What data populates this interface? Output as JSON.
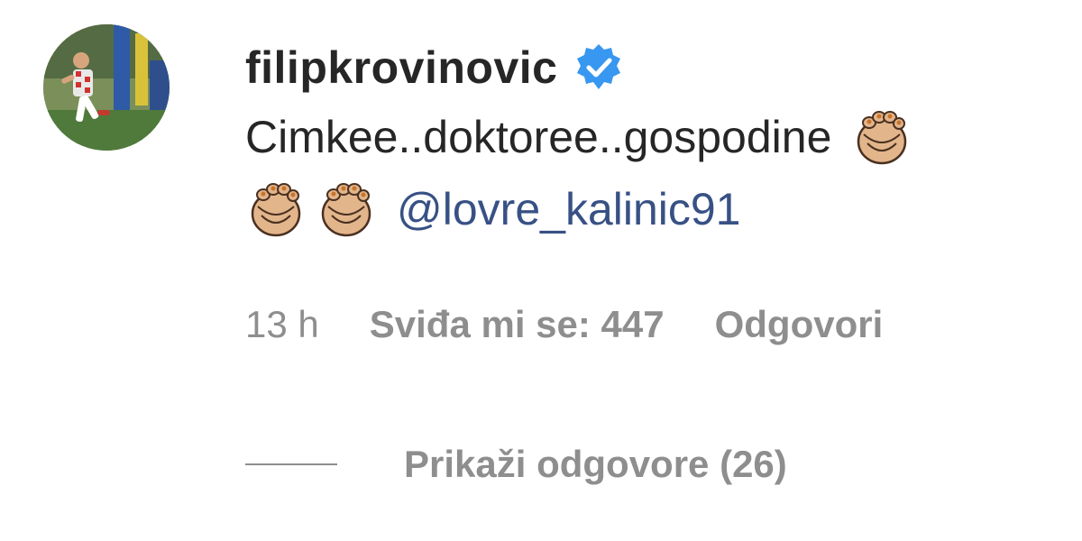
{
  "comment": {
    "username": "filipkrovinovic",
    "verified": true,
    "text": "Cimkee..doktoree..gospodine",
    "emoji": "clapping-hands",
    "emoji_count": 3,
    "mention": "@lovre_kalinic91",
    "time": "13 h",
    "likes": "Sviđa mi se: 447",
    "reply": "Odgovori",
    "view_replies": "Prikaži odgovore (26)"
  },
  "colors": {
    "text": "#262626",
    "secondary": "#8e8e8e",
    "mention": "#385185",
    "verified": "#3897f0",
    "clap": "#e2b58b"
  },
  "icons": {
    "avatar": "profile-photo",
    "badge": "verified-badge-icon",
    "clap": "clapping-hands-icon"
  }
}
